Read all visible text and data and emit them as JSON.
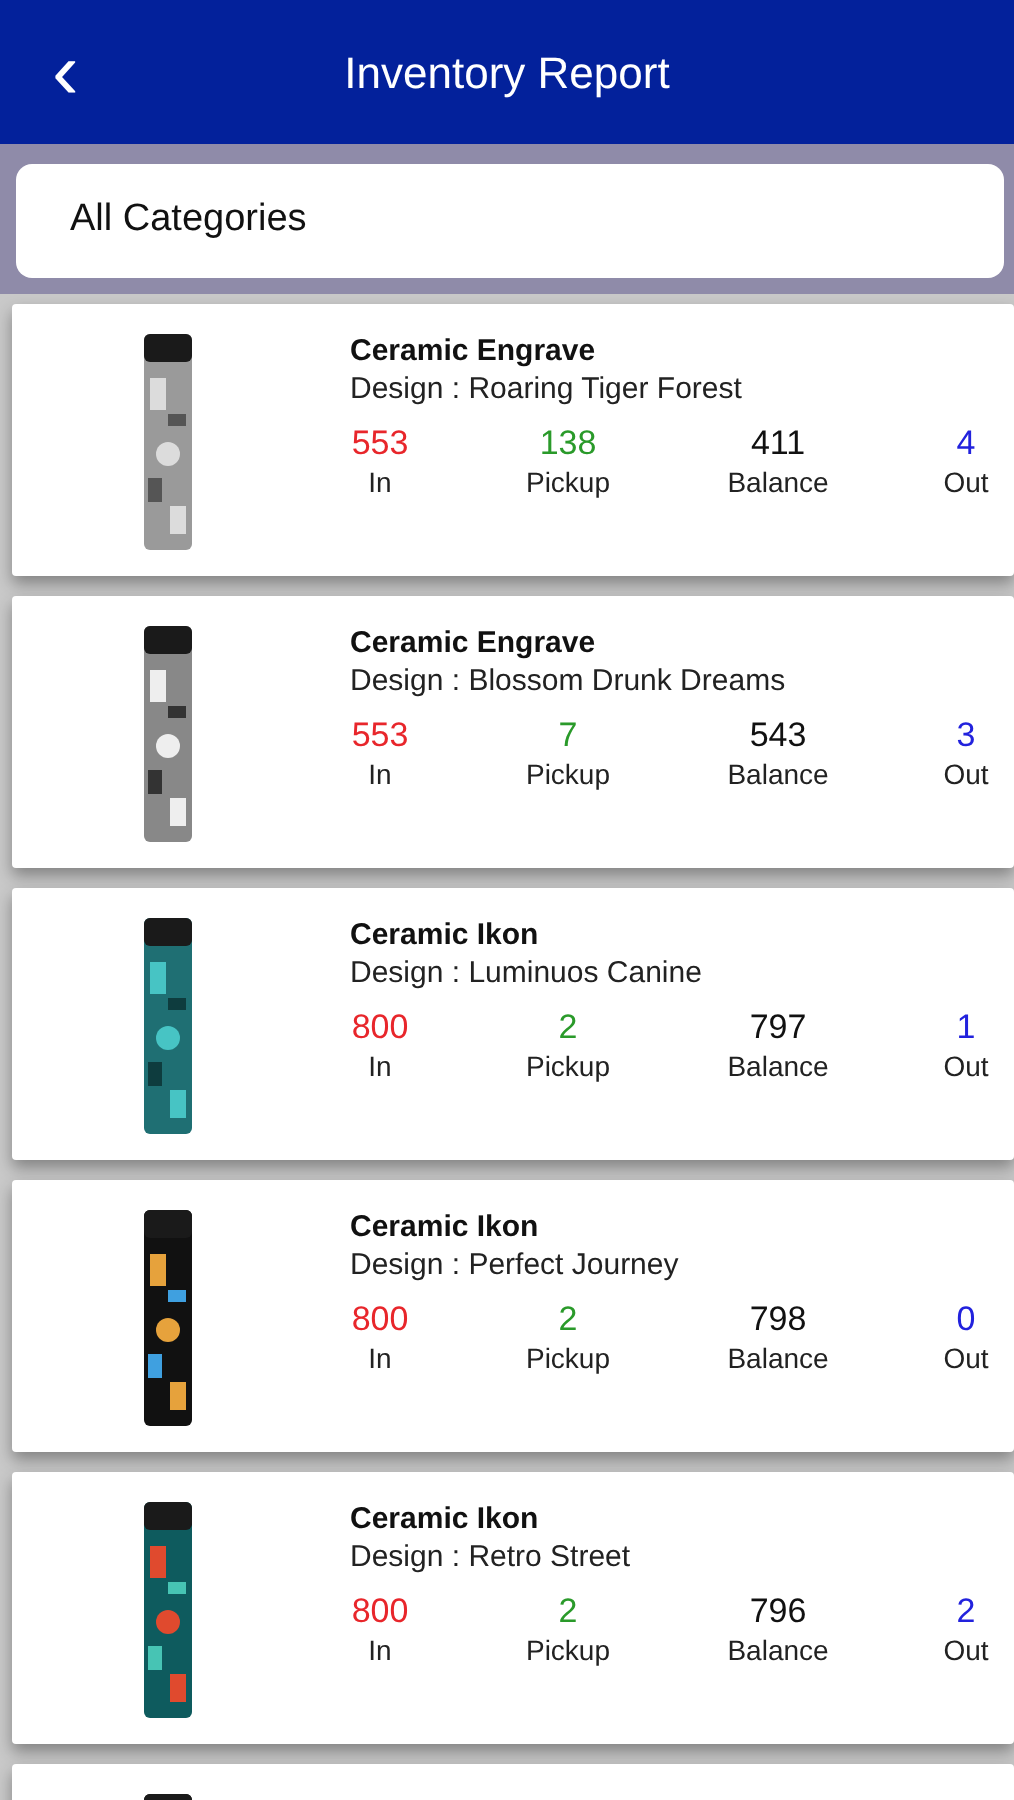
{
  "header": {
    "title": "Inventory Report",
    "back": "‹"
  },
  "filter": {
    "value": "All Categories"
  },
  "products": [
    {
      "kind": "full",
      "name": "Ceramic Engrave",
      "design": "Design : Roaring Tiger Forest",
      "stats": [
        {
          "value": "553",
          "label": "In",
          "color": "#e8262b"
        },
        {
          "value": "138",
          "label": "Pickup",
          "color": "#2a9a2a"
        },
        {
          "value": "411",
          "label": "Balance",
          "color": "#111111"
        },
        {
          "value": "4",
          "label": "Out",
          "color": "#2222dd"
        }
      ]
    },
    {
      "kind": "full",
      "name": "Ceramic Engrave",
      "design": "Design : Blossom Drunk Dreams",
      "stats": [
        {
          "value": "553",
          "label": "In",
          "color": "#e8262b"
        },
        {
          "value": "7",
          "label": "Pickup",
          "color": "#2a9a2a"
        },
        {
          "value": "543",
          "label": "Balance",
          "color": "#111111"
        },
        {
          "value": "3",
          "label": "Out",
          "color": "#2222dd"
        }
      ]
    },
    {
      "kind": "full",
      "name": "Ceramic Ikon",
      "design": "Design : Luminuos Canine",
      "stats": [
        {
          "value": "800",
          "label": "In",
          "color": "#e8262b"
        },
        {
          "value": "2",
          "label": "Pickup",
          "color": "#2a9a2a"
        },
        {
          "value": "797",
          "label": "Balance",
          "color": "#111111"
        },
        {
          "value": "1",
          "label": "Out",
          "color": "#2222dd"
        }
      ]
    },
    {
      "kind": "full",
      "name": "Ceramic Ikon",
      "design": "Design : Perfect Journey",
      "stats": [
        {
          "value": "800",
          "label": "In",
          "color": "#e8262b"
        },
        {
          "value": "2",
          "label": "Pickup",
          "color": "#2a9a2a"
        },
        {
          "value": "798",
          "label": "Balance",
          "color": "#111111"
        },
        {
          "value": "0",
          "label": "Out",
          "color": "#2222dd"
        }
      ]
    },
    {
      "kind": "full",
      "name": "Ceramic Ikon",
      "design": "Design : Retro Street",
      "stats": [
        {
          "value": "800",
          "label": "In",
          "color": "#e8262b"
        },
        {
          "value": "2",
          "label": "Pickup",
          "color": "#2a9a2a"
        },
        {
          "value": "796",
          "label": "Balance",
          "color": "#111111"
        },
        {
          "value": "2",
          "label": "Out",
          "color": "#2222dd"
        }
      ]
    },
    {
      "kind": "cut"
    }
  ]
}
